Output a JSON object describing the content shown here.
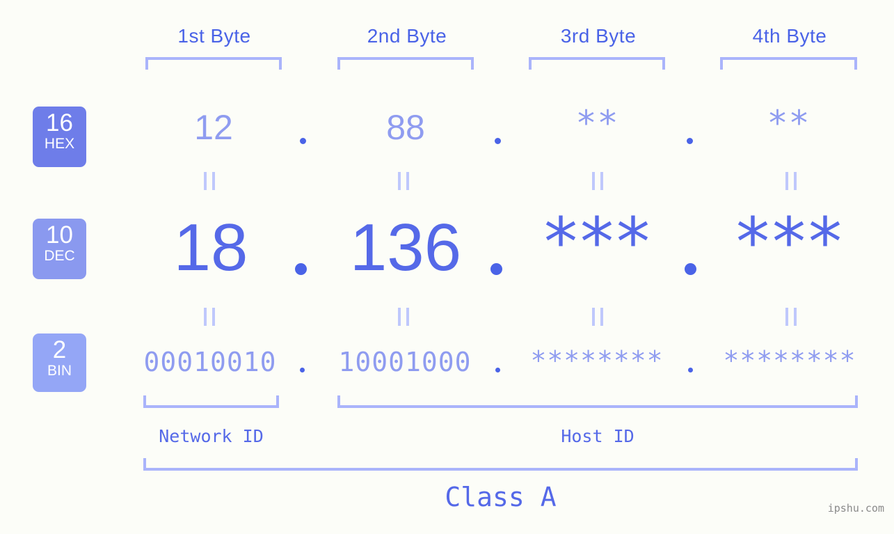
{
  "page": {
    "background": "#fcfdf8",
    "accent_strong": "#4a63e7",
    "accent_mid": "#8f9cf0",
    "accent_light": "#aab4fb",
    "watermark": "ipshu.com"
  },
  "byte_headers": [
    {
      "label": "1st Byte"
    },
    {
      "label": "2nd Byte"
    },
    {
      "label": "3rd Byte"
    },
    {
      "label": "4th Byte"
    }
  ],
  "bases": [
    {
      "number": "16",
      "name": "HEX",
      "color": "#6e7de9"
    },
    {
      "number": "10",
      "name": "DEC",
      "color": "#8a99ef"
    },
    {
      "number": "2",
      "name": "BIN",
      "color": "#94a6f6"
    }
  ],
  "rows": {
    "hex": {
      "values": [
        "12",
        "88",
        "**",
        "**"
      ],
      "separator": "."
    },
    "dec": {
      "values": [
        "18",
        "136",
        "***",
        "***"
      ],
      "separator": "."
    },
    "bin": {
      "values": [
        "00010010",
        "10001000",
        "********",
        "********"
      ],
      "separator": "."
    }
  },
  "equals": {
    "symbol": "="
  },
  "segments": {
    "network": {
      "label": "Network ID"
    },
    "host": {
      "label": "Host ID"
    },
    "class": {
      "label": "Class A"
    }
  }
}
